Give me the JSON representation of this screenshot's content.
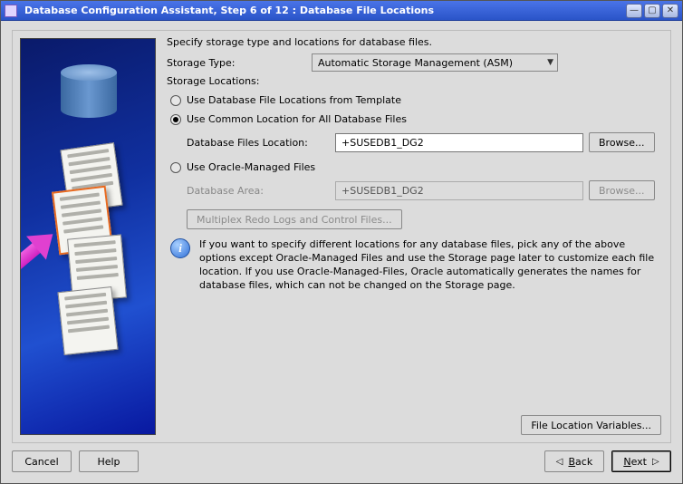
{
  "window": {
    "title": "Database Configuration Assistant, Step 6 of 12 : Database File Locations"
  },
  "intro": "Specify storage type and locations for database files.",
  "storage_type": {
    "label": "Storage Type:",
    "value": "Automatic Storage Management (ASM)"
  },
  "storage_locations_label": "Storage Locations:",
  "radios": {
    "template": "Use Database File Locations from Template",
    "common": "Use Common Location for All Database Files",
    "omf": "Use Oracle-Managed Files",
    "selected": "common"
  },
  "common": {
    "label": "Database Files Location:",
    "value": "+SUSEDB1_DG2",
    "browse": "Browse..."
  },
  "omf": {
    "label": "Database Area:",
    "value": "+SUSEDB1_DG2",
    "browse": "Browse...",
    "multiplex": "Multiplex Redo Logs and Control Files..."
  },
  "info": "If you want to specify different locations for any database files, pick any of the above options except Oracle-Managed Files and use the Storage page later to customize each file location. If you use Oracle-Managed-Files, Oracle automatically generates the names for database files, which can not be changed on the Storage page.",
  "file_loc_vars": "File Location Variables...",
  "buttons": {
    "cancel": "Cancel",
    "help": "Help",
    "back": "Back",
    "next": "Next"
  }
}
